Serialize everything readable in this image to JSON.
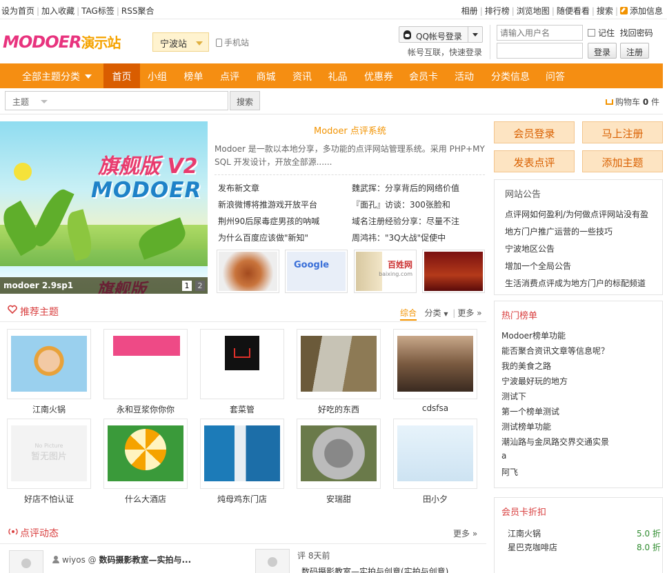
{
  "topbar": {
    "left": [
      "设为首页",
      "加入收藏",
      "TAG标签",
      "RSS聚合"
    ],
    "right": [
      "相册",
      "排行榜",
      "浏览地图",
      "随便看看",
      "搜索"
    ],
    "add_info": "添加信息"
  },
  "header": {
    "logo_main": "MODOER",
    "logo_sub": "演示站",
    "city": "宁波站",
    "mobile": "手机站",
    "qq_login": "QQ帐号登录",
    "qq_sub": "帐号互联，快速登录",
    "username_placeholder": "请输入用户名",
    "remember": "记住",
    "forgot": "找回密码",
    "login": "登录",
    "register": "注册"
  },
  "nav": {
    "all": "全部主题分类",
    "items": [
      "首页",
      "小组",
      "榜单",
      "点评",
      "商城",
      "资讯",
      "礼品",
      "优惠券",
      "会员卡",
      "活动",
      "分类信息",
      "问答"
    ]
  },
  "search": {
    "scope": "主题",
    "button": "搜索",
    "cart_label": "购物车",
    "cart_count": "0",
    "cart_unit": "件"
  },
  "slider": {
    "title1": "旗舰版",
    "title1_suffix": "V2",
    "title2": "MODOER",
    "caption": "modoer 2.9sp1",
    "pages": [
      "1",
      "2"
    ]
  },
  "intro": {
    "title": "Modoer 点评系统",
    "desc": "Modoer 是一款以本地分享，多功能的点评网站管理系统。采用 PHP+MYSQL 开发设计，开放全部源......",
    "articles_left": [
      "发布新文章",
      "新浪微博将推游戏开放平台",
      "荆州90后尿毒症男孩的呐喊",
      "为什么百度应该做\"新知\""
    ],
    "articles_right": [
      "魏武挥：分享背后的网络价值",
      "『面孔』访谈：300张脸和",
      "域名注册经验分享：尽量不注",
      "周鸿祎：\"3Q大战\"促使中"
    ],
    "thumb_text": [
      "Google",
      "百姓网",
      "baixing.com"
    ]
  },
  "right": {
    "buttons": [
      "会员登录",
      "马上注册",
      "发表点评",
      "添加主题"
    ],
    "notice_title": "网站公告",
    "notices": [
      "点评网如何盈利/为何做点评网站没有盈",
      "地方门户推广运营的一些技巧",
      "宁波地区公告",
      "增加一个全局公告",
      "生活消费点评成为地方门户的标配频道"
    ],
    "hot_title": "热门榜单",
    "hot": [
      "Modoer榜单功能",
      "能否聚合资讯文章等信息呢？",
      "我的美食之路",
      "宁波最好玩的地方",
      "测试下",
      "第一个榜单测试",
      "测试榜单功能",
      "潮汕路与金凤路交界交通实景",
      "a",
      "阿飞"
    ],
    "card_title": "会员卡折扣",
    "cards": [
      {
        "name": "江南火锅",
        "discount": "5.0 折"
      },
      {
        "name": "星巴克咖啡店",
        "discount": "8.0 折"
      }
    ]
  },
  "recommend": {
    "title": "推荐主题",
    "tab_on": "综合",
    "tab_cat": "分类",
    "more": "更多",
    "nopic": "No Picture",
    "nopic_cn": "暂无图片",
    "items": [
      "江南火锅",
      "永和豆浆你你你",
      "套菜管",
      "好吃的东西",
      "cdsfsa",
      "好店不怕认证",
      "什么大酒店",
      "炖母鸡东门店",
      "安瑞甜",
      "田小夕"
    ]
  },
  "reviews": {
    "title": "点评动态",
    "more": "更多",
    "user": "wiyos",
    "at": "@",
    "subject": "数码摄影教室—实拍与...",
    "label": "评",
    "time": "8天前",
    "body": "数码摄影教室—实拍与创意(实拍与创意)"
  },
  "colors": {
    "accent": "#f58e12",
    "nav_active": "#d95d00",
    "section_title": "#d94040",
    "discount": "#2e8b2e"
  }
}
